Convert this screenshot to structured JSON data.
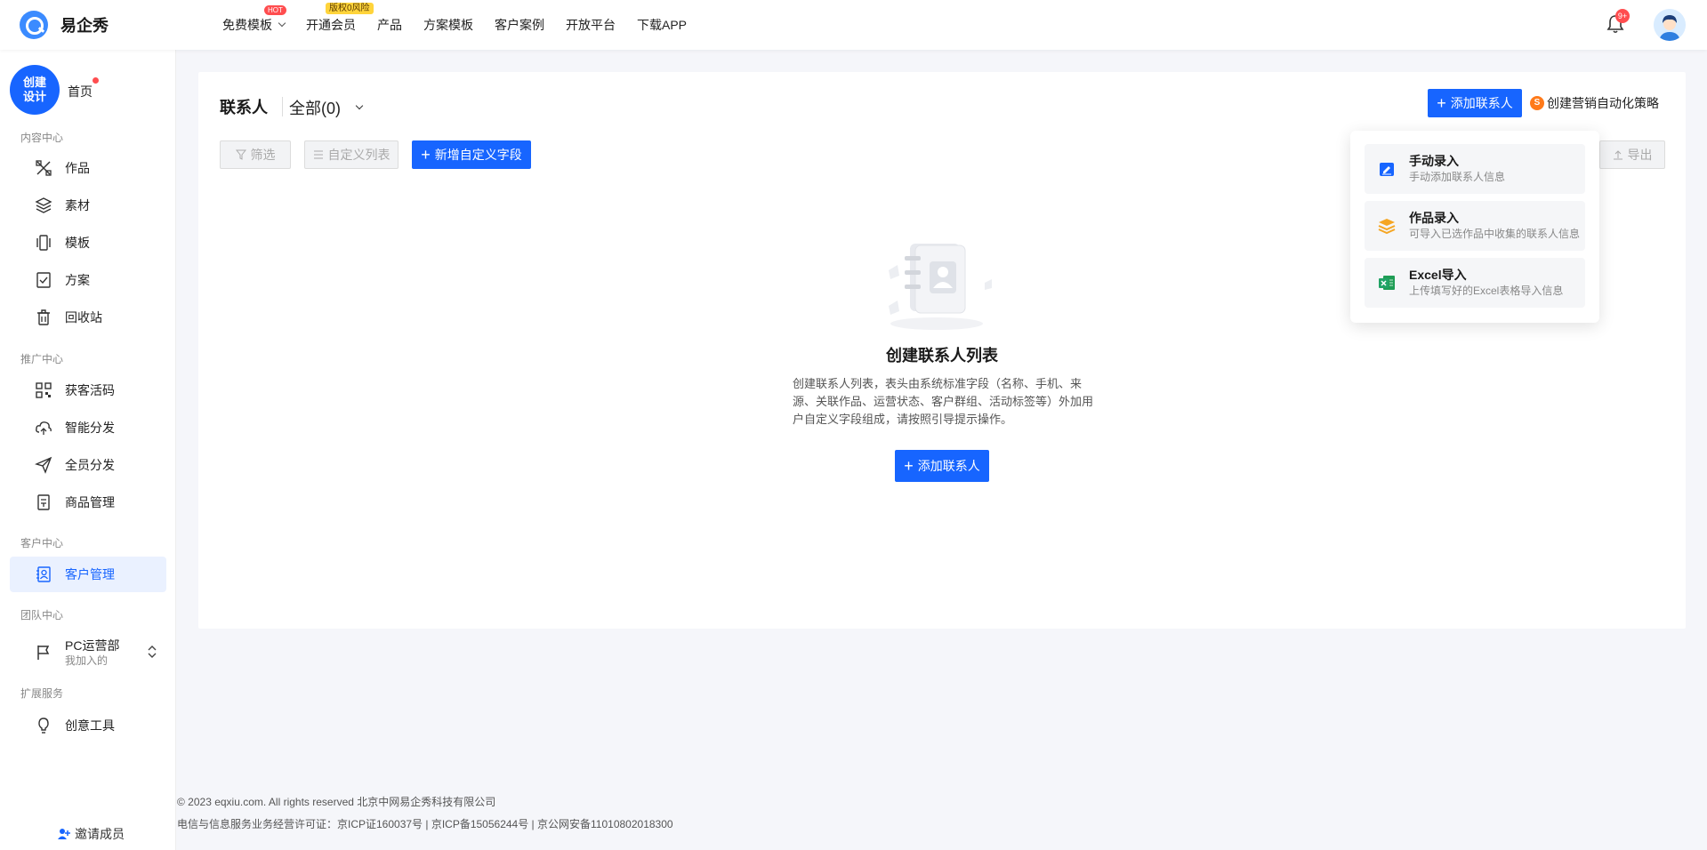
{
  "app": {
    "name": "易企秀"
  },
  "topnav": {
    "items": [
      {
        "label": "免费模板",
        "badge": "HOT"
      },
      {
        "label": "开通会员",
        "badge": "版权0风险"
      },
      {
        "label": "产品"
      },
      {
        "label": "方案模板"
      },
      {
        "label": "客户案例"
      },
      {
        "label": "开放平台"
      },
      {
        "label": "下载APP"
      }
    ],
    "notification_count": "9+"
  },
  "sidebar": {
    "create_button": {
      "line1": "创建",
      "line2": "设计"
    },
    "home": "首页",
    "sections": [
      {
        "title": "内容中心",
        "items": [
          {
            "label": "作品",
            "icon": "tools-icon"
          },
          {
            "label": "素材",
            "icon": "layers-icon"
          },
          {
            "label": "模板",
            "icon": "template-icon"
          },
          {
            "label": "方案",
            "icon": "checklist-icon"
          },
          {
            "label": "回收站",
            "icon": "trash-icon"
          }
        ]
      },
      {
        "title": "推广中心",
        "items": [
          {
            "label": "获客活码",
            "icon": "qrcode-icon"
          },
          {
            "label": "智能分发",
            "icon": "cloud-share-icon"
          },
          {
            "label": "全员分发",
            "icon": "send-icon"
          },
          {
            "label": "商品管理",
            "icon": "product-icon"
          }
        ]
      },
      {
        "title": "客户中心",
        "items": [
          {
            "label": "客户管理",
            "icon": "contact-icon",
            "active": true
          }
        ]
      },
      {
        "title": "团队中心"
      },
      {
        "title": "扩展服务",
        "items": [
          {
            "label": "创意工具",
            "icon": "bulb-icon"
          }
        ]
      }
    ],
    "team": {
      "name": "PC运营部",
      "sub": "我加入的"
    },
    "invite": "邀请成员"
  },
  "main": {
    "title": "联系人",
    "scope": "全部(0)",
    "toolbar": {
      "filter": "筛选",
      "custom_columns": "自定义列表",
      "add_field": "新增自定义字段",
      "export": "导出",
      "add_contact": "添加联系人",
      "automation": "创建营销自动化策略",
      "automation_badge": "S"
    },
    "empty": {
      "title": "创建联系人列表",
      "desc": "创建联系人列表，表头由系统标准字段（名称、手机、来源、关联作品、运营状态、客户群组、活动标签等）外加用户自定义字段组成，请按照引导提示操作。",
      "button": "添加联系人"
    }
  },
  "dropdown": {
    "items": [
      {
        "title": "手动录入",
        "sub": "手动添加联系人信息"
      },
      {
        "title": "作品录入",
        "sub": "可导入已选作品中收集的联系人信息"
      },
      {
        "title": "Excel导入",
        "sub": "上传填写好的Excel表格导入信息"
      }
    ]
  },
  "footer": {
    "line1": "© 2023 eqxiu.com. All rights reserved 北京中网易企秀科技有限公司",
    "line2": "电信与信息服务业务经营许可证：京ICP证160037号 | 京ICP备15056244号 | 京公网安备11010802018300"
  },
  "colors": {
    "primary": "#1765ff",
    "badge_red": "#ff4d4f",
    "vip_yellow": "#ffd43b",
    "active_bg": "#eaf1ff"
  }
}
